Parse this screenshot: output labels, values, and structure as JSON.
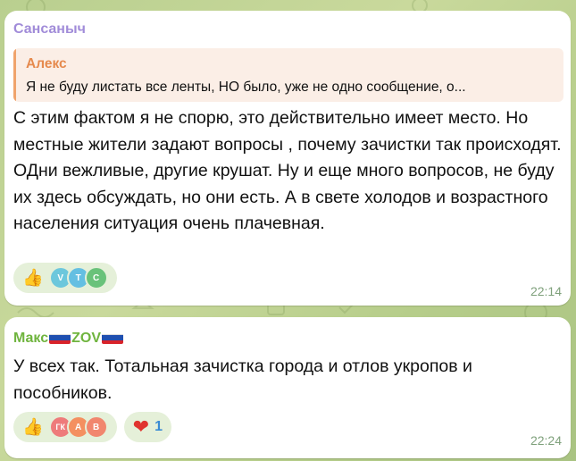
{
  "colors": {
    "sender1": "#a18cd9",
    "sender2": "#6fb43e",
    "reply_accent": "#f0a36b",
    "bubble": "#ffffff",
    "reaction_bg": "#e5f0d9",
    "time": "#7fa17c"
  },
  "messages": [
    {
      "sender": "Сансаныч",
      "reply": {
        "author": "Алекс",
        "text": "Я не буду листать все ленты, НО было, уже не одно сообщение, о..."
      },
      "text": "С этим фактом я не спорю, это действительно имеет место. Но местные жители задают вопросы , почему зачистки так происходят. ОДни вежливые, другие крушат. Ну и еще много вопросов, не буду их здесь обсуждать, но они есть. А в свете холодов и возрастного населения ситуация очень плачевная.",
      "reactions": [
        {
          "emoji": "👍",
          "icon": "thumbs-up-icon",
          "avatars": [
            {
              "initials": "V",
              "color": "#6cc7dc"
            },
            {
              "initials": "T",
              "color": "#64bfe2"
            },
            {
              "initials": "C",
              "color": "#69c27a"
            }
          ]
        }
      ],
      "time": "22:14"
    },
    {
      "sender_parts": [
        "Макс",
        "ZOV"
      ],
      "text": "У всех так. Тотальная зачистка города и отлов укропов и пособников.",
      "reactions": [
        {
          "emoji": "👍",
          "icon": "thumbs-up-icon",
          "avatars": [
            {
              "initials": "ГК",
              "color": "#ee7b7b"
            },
            {
              "initials": "А",
              "color": "#f49060"
            },
            {
              "initials": "В",
              "color": "#f1866e"
            }
          ]
        },
        {
          "emoji": "❤",
          "icon": "heart-icon",
          "count": "1"
        }
      ],
      "time": "22:24"
    }
  ]
}
